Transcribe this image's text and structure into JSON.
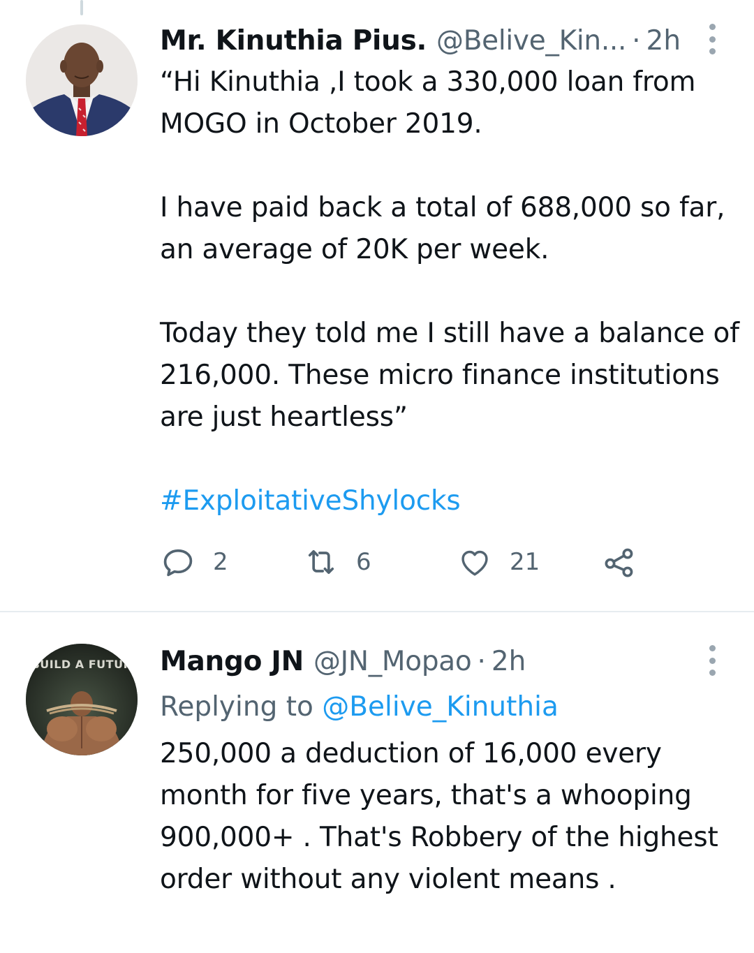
{
  "tweet1": {
    "name": "Mr. Kinuthia Pius.",
    "handle": "@Belive_Kin...",
    "separator": "·",
    "time": "2h",
    "paragraphs": [
      "“Hi Kinuthia ,I took a 330,000 loan from MOGO in October 2019.",
      "I have paid back a total of 688,000 so far, an average of 20K per week.",
      "Today they told me I still have a balance of 216,000. These micro finance institutions are just heartless”"
    ],
    "hashtag": "#ExploitativeShylocks",
    "actions": {
      "reply_count": "2",
      "retweet_count": "6",
      "like_count": "21"
    },
    "icons": [
      "reply-icon",
      "retweet-icon",
      "like-icon",
      "share-icon",
      "more-icon"
    ]
  },
  "tweet2": {
    "name": "Mango JN",
    "handle": "@JN_Mopao",
    "separator": "·",
    "time": "2h",
    "replying_prefix": "Replying to",
    "replying_handle": "@Belive_Kinuthia",
    "avatar_text": "BUILD A FUTUR",
    "body": "250,000 a deduction of 16,000 every month for five years, that's a whooping 900,000+ . That's Robbery of the highest order without any violent means ."
  },
  "colors": {
    "text": "#0f1419",
    "secondary": "#536471",
    "link": "#1d9bf0",
    "divider": "#e6ecf0"
  }
}
